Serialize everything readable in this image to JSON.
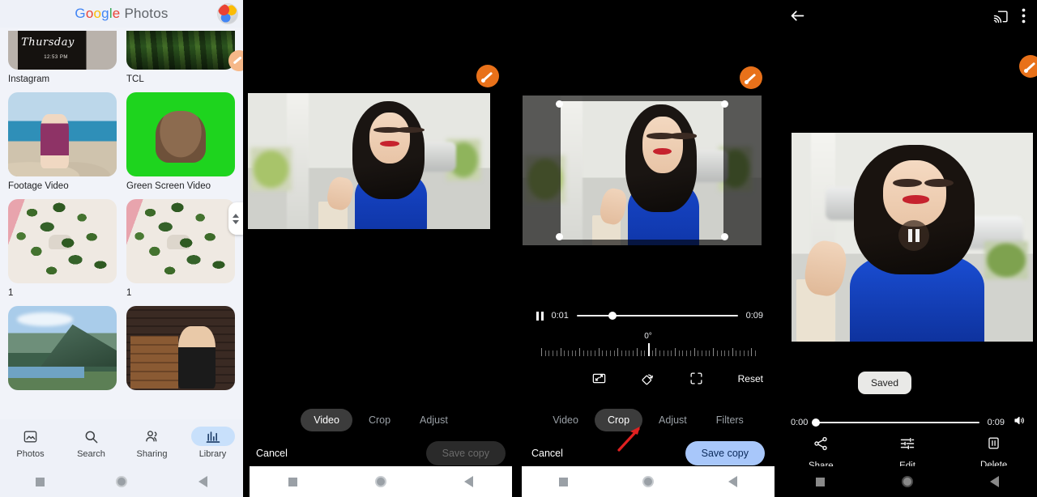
{
  "panel_library": {
    "app_title_part1": "Google",
    "app_title_part2": "Photos",
    "avatar_name": "account-avatar",
    "grid_items": [
      {
        "caption": "Instagram",
        "art": "insta"
      },
      {
        "caption": "TCL",
        "art": "tcl"
      },
      {
        "caption": "Footage Video",
        "art": "beach"
      },
      {
        "caption": "Green Screen Video",
        "art": "green"
      },
      {
        "caption": "1",
        "art": "plant"
      },
      {
        "caption": "1",
        "art": "plant"
      },
      {
        "caption": "",
        "art": "lake"
      },
      {
        "caption": "",
        "art": "brick"
      }
    ],
    "thursday_overlay": "Thursday",
    "thursday_time": "12:53 PM",
    "nav": [
      {
        "label": "Photos",
        "icon": "photo-icon",
        "active": false
      },
      {
        "label": "Search",
        "icon": "search-icon",
        "active": false
      },
      {
        "label": "Sharing",
        "icon": "sharing-icon",
        "active": false
      },
      {
        "label": "Library",
        "icon": "library-icon",
        "active": true
      }
    ]
  },
  "panel_video_tab": {
    "tabs": [
      {
        "label": "Video",
        "active": true
      },
      {
        "label": "Crop",
        "active": false
      },
      {
        "label": "Adjust",
        "active": false
      }
    ],
    "cancel_label": "Cancel",
    "save_label": "Save copy",
    "save_enabled": false,
    "edit_badge": "pencil-badge"
  },
  "panel_crop_tab": {
    "tabs": [
      {
        "label": "Video",
        "active": false
      },
      {
        "label": "Crop",
        "active": true
      },
      {
        "label": "Adjust",
        "active": false
      },
      {
        "label": "Filters",
        "active": false
      }
    ],
    "cancel_label": "Cancel",
    "save_label": "Save copy",
    "save_enabled": true,
    "timeline": {
      "current": "0:01",
      "duration": "0:09",
      "progress_percent": 22,
      "pause_icon": "pause-icon"
    },
    "rotation": {
      "value_label": "0°",
      "ticks": 57
    },
    "tools": [
      {
        "name": "aspect-ratio-icon",
        "label": ""
      },
      {
        "name": "rotate-icon",
        "label": ""
      },
      {
        "name": "reframe-icon",
        "label": ""
      }
    ],
    "reset_label": "Reset",
    "annotation_arrow": "red-arrow-pointing-to-crop-tab",
    "edit_badge": "pencil-badge"
  },
  "panel_player": {
    "back_icon": "back-arrow-icon",
    "cast_icon": "cast-icon",
    "more_icon": "more-vertical-icon",
    "toast_label": "Saved",
    "timeline": {
      "current": "0:00",
      "duration": "0:09",
      "progress_percent": 0,
      "volume_icon": "volume-icon"
    },
    "pause_overlay_icon": "pause-icon",
    "actions": [
      {
        "label": "Share",
        "icon": "share-icon"
      },
      {
        "label": "Edit",
        "icon": "tune-icon"
      },
      {
        "label": "Delete",
        "icon": "delete-icon"
      }
    ],
    "edit_badge": "pencil-badge"
  },
  "system_bar": {
    "recent_icon": "square-recents-icon",
    "home_icon": "circle-home-icon",
    "back_icon": "triangle-back-icon"
  },
  "colors": {
    "accent_blue": "#a8c7fa",
    "badge_orange": "#e8711a",
    "nav_pill": "#c8e0fb",
    "arrow_red": "#e02020"
  }
}
